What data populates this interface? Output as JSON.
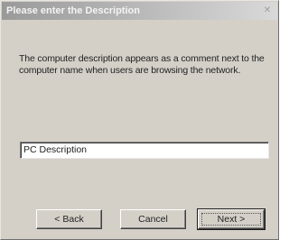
{
  "window": {
    "title": "Please enter the Description",
    "close_symbol": "✕"
  },
  "description": "The computer description appears as a comment next to the computer name when users are browsing the network.",
  "input": {
    "value": "PC Description"
  },
  "buttons": {
    "back_label": "< Back",
    "cancel_label": "Cancel",
    "next_label": "Next >"
  }
}
